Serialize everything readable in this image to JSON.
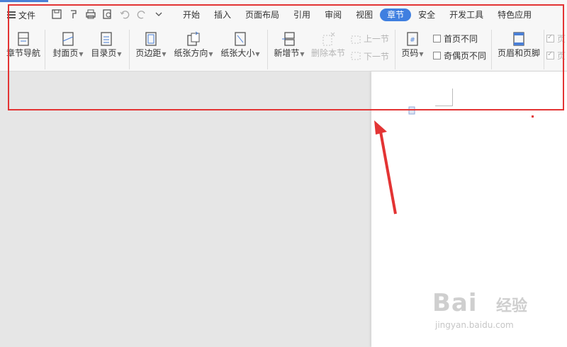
{
  "menu": {
    "file_label": "文件"
  },
  "tabs": [
    "开始",
    "插入",
    "页面布局",
    "引用",
    "审阅",
    "视图",
    "章节",
    "安全",
    "开发工具",
    "特色应用"
  ],
  "active_tab": "章节",
  "ribbon": {
    "nav": "章节导航",
    "cover": "封面页",
    "toc": "目录页",
    "margin": "页边距",
    "orientation": "纸张方向",
    "size": "纸张大小",
    "new_section": "新增节",
    "delete_section": "删除本节",
    "prev_section": "上一节",
    "next_section": "下一节",
    "page_number": "页码",
    "first_page_diff": "首页不同",
    "odd_even_diff": "奇偶页不同",
    "header_footer": "页眉和页脚",
    "right_cut_1": "页",
    "right_cut_2": "页"
  },
  "watermark": {
    "brand": "Bai",
    "brand_cn": "经验",
    "url": "jingyan.baidu.com"
  },
  "colors": {
    "accent": "#3f7fe0",
    "highlight": "#e33434"
  }
}
